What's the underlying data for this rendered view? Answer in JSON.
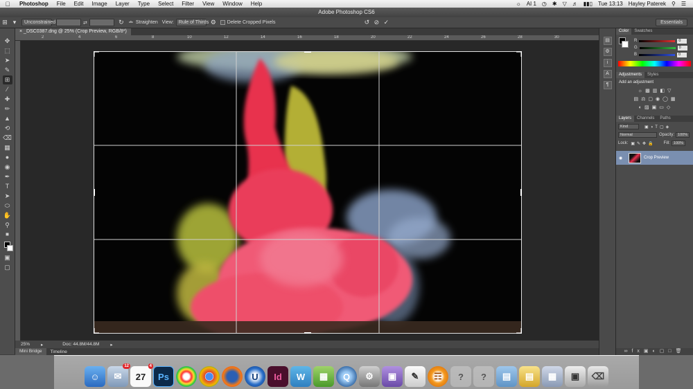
{
  "menubar": {
    "app_name": "Photoshop",
    "items": [
      "File",
      "Edit",
      "Image",
      "Layer",
      "Type",
      "Select",
      "Filter",
      "View",
      "Window",
      "Help"
    ],
    "ai_badge": "AI 1",
    "clock": "Tue 13:13",
    "user": "Hayley Paterek"
  },
  "window": {
    "title": "Adobe Photoshop CS6"
  },
  "options": {
    "ratio": "Unconstrained",
    "straighten": "Straighten",
    "view_label": "View:",
    "view_value": "Rule of Thirds",
    "delete_cropped": "Delete Cropped Pixels",
    "workspace": "Essentials"
  },
  "document": {
    "tab": "_DSC0387.dng @ 25% (Crop Preview, RGB/8*)",
    "zoom": "25%",
    "doc_info": "Doc: 44.8M/44.8M"
  },
  "ruler_marks": [
    "2",
    "4",
    "6",
    "8",
    "10",
    "12",
    "14",
    "16",
    "18",
    "20",
    "22",
    "24",
    "26",
    "28",
    "30"
  ],
  "bottom_tabs": [
    "Mini Bridge",
    "Timeline"
  ],
  "panels": {
    "color_tabs": [
      "Color",
      "Swatches"
    ],
    "rgb": [
      {
        "ch": "R",
        "value": "0",
        "color": "#e83030"
      },
      {
        "ch": "G",
        "value": "0",
        "color": "#30c040"
      },
      {
        "ch": "B",
        "value": "0",
        "color": "#3050e0"
      }
    ],
    "adj_tabs": [
      "Adjustments",
      "Styles"
    ],
    "add_adjustment": "Add an adjustment",
    "layer_tabs": [
      "Layers",
      "Channels",
      "Paths"
    ],
    "kind": "Kind",
    "blend": "Normal",
    "opacity_label": "Opacity:",
    "opacity": "100%",
    "lock_label": "Lock:",
    "fill_label": "Fill:",
    "fill": "100%",
    "layer_name": "Crop Preview"
  },
  "dock": {
    "calendar_day": "27",
    "badges": {
      "mail": "12",
      "calendar": "4"
    },
    "apps": [
      "finder",
      "mail",
      "calendar",
      "photoshop",
      "colorsync",
      "chrome",
      "firefox",
      "unity",
      "indesign",
      "word",
      "sitemap",
      "quicktime",
      "preferences",
      "stickies",
      "notes",
      "ibooks",
      "folder",
      "documents",
      "preview",
      "camera",
      "trash"
    ]
  }
}
